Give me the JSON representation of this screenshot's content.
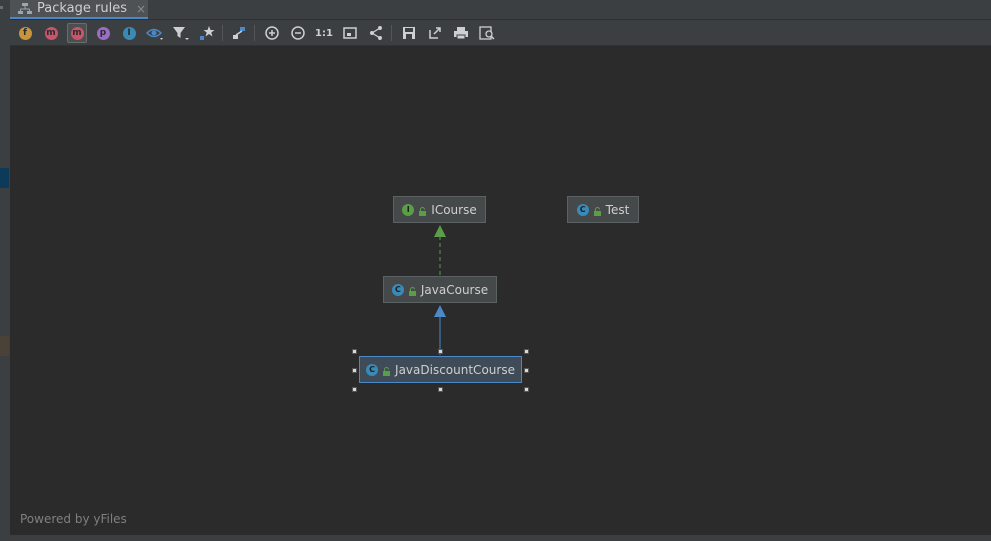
{
  "tab": {
    "title": "Package rules",
    "close": "×"
  },
  "toolbar": {
    "fields_label": "f",
    "constructors_label": "m",
    "methods_label": "m",
    "properties_label": "p",
    "inner_label": "I",
    "zoom_actual_label": "1:1"
  },
  "diagram": {
    "nodes": {
      "icourse": {
        "label": "ICourse",
        "kind_badge": "I",
        "kind": "interface"
      },
      "test": {
        "label": "Test",
        "kind_badge": "C",
        "kind": "class"
      },
      "javacourse": {
        "label": "JavaCourse",
        "kind_badge": "C",
        "kind": "class"
      },
      "javadiscountcourse": {
        "label": "JavaDiscountCourse",
        "kind_badge": "C",
        "kind": "class",
        "selected": true
      }
    },
    "edges": [
      {
        "from": "JavaCourse",
        "to": "ICourse",
        "type": "implements",
        "style": "dashed",
        "color": "#5a9e47"
      },
      {
        "from": "JavaDiscountCourse",
        "to": "JavaCourse",
        "type": "extends",
        "style": "solid",
        "color": "#4a88c7"
      }
    ],
    "footer": "Powered by yFiles"
  },
  "colors": {
    "interface_badge": "#5a9e47",
    "class_badge": "#3a8ab8",
    "fields_badge": "#c9953c",
    "methods_badge": "#c7556b",
    "properties_badge": "#9b6dc6",
    "selection": "#4a88c7"
  }
}
